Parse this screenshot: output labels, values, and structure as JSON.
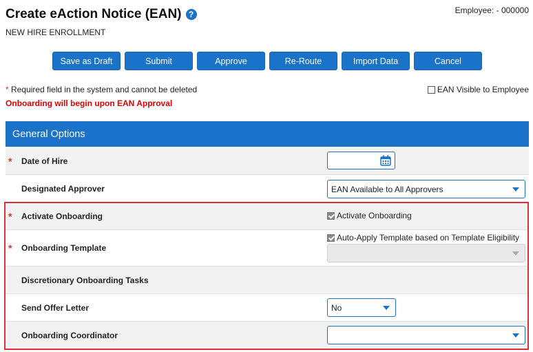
{
  "header": {
    "title": "Create eAction Notice (EAN)",
    "help_icon": "?",
    "subtitle": "NEW HIRE ENROLLMENT",
    "employee": "Employee: - 000000"
  },
  "toolbar": {
    "buttons": [
      "Save as Draft",
      "Submit",
      "Approve",
      "Re-Route",
      "Import Data",
      "Cancel"
    ]
  },
  "notes": {
    "required_star": "*",
    "required_text": " Required field in the system and cannot be deleted",
    "onboarding_text": "Onboarding will begin upon EAN Approval",
    "visible_label": "EAN Visible to Employee",
    "visible_checked": false
  },
  "panel": {
    "title": "General Options",
    "rows": {
      "date_of_hire": {
        "label": "Date of Hire",
        "required": true,
        "value": ""
      },
      "designated_approver": {
        "label": "Designated Approver",
        "value": "EAN Available to All Approvers"
      },
      "activate_onboarding": {
        "label": "Activate Onboarding",
        "required": true,
        "checkbox_label": "Activate Onboarding",
        "checked": true
      },
      "onboarding_template": {
        "label": "Onboarding Template",
        "required": true,
        "checkbox_label": "Auto-Apply Template based on Template Eligibility",
        "checked": true,
        "value": ""
      },
      "discretionary_tasks": {
        "label": "Discretionary Onboarding Tasks"
      },
      "send_offer_letter": {
        "label": "Send Offer Letter",
        "value": "No"
      },
      "onboarding_coordinator": {
        "label": "Onboarding Coordinator",
        "value": ""
      }
    }
  },
  "colors": {
    "accent": "#1a73c8",
    "required": "#d0352b",
    "warning_text": "#e00000",
    "highlight_border": "#d9303a"
  },
  "icons": {
    "help": "help-icon",
    "calendar": "calendar-icon",
    "dropdown": "chevron-down-icon",
    "checkbox": "checkbox-icon"
  }
}
